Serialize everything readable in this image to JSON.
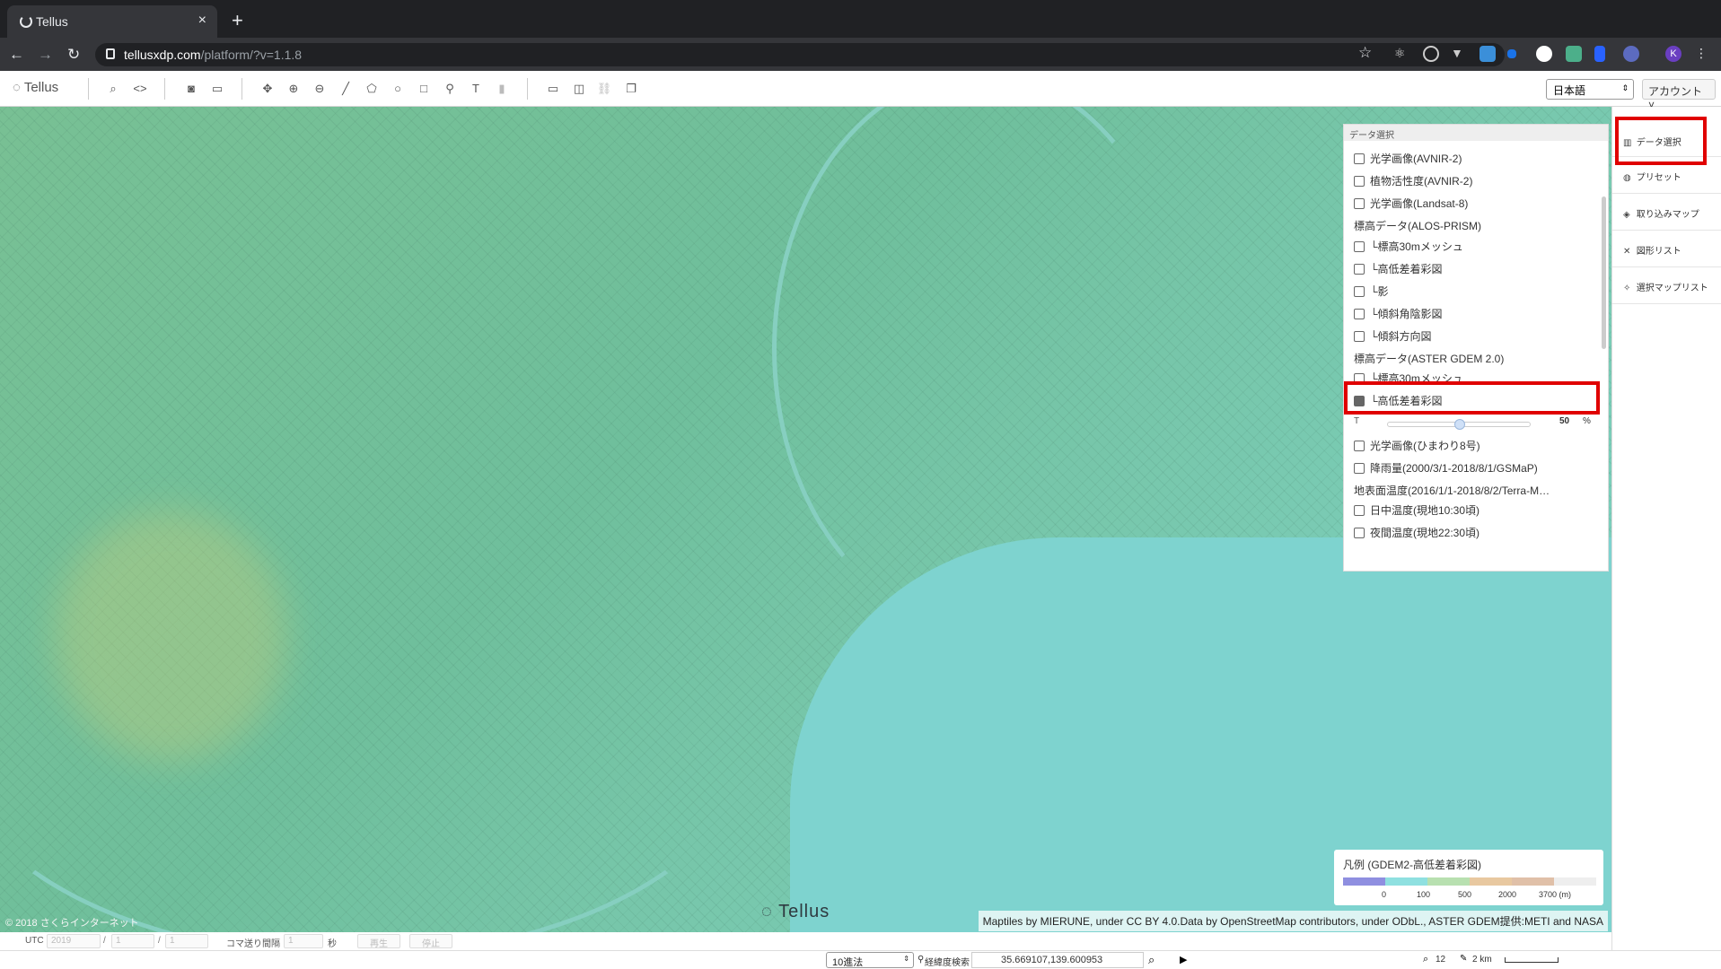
{
  "browser": {
    "tab_title": "Tellus",
    "url_host": "tellusxdp.com",
    "url_path": "/platform/?v=1.1.8",
    "profile_initial": "K"
  },
  "toolbar": {
    "logo": "Tellus",
    "language": "日本語",
    "account": "アカウント"
  },
  "data_panel": {
    "header": "データ選択",
    "items": [
      {
        "label": "光学画像(AVNIR-2)",
        "type": "check",
        "checked": false
      },
      {
        "label": "植物活性度(AVNIR-2)",
        "type": "check",
        "checked": false
      },
      {
        "label": "光学画像(Landsat-8)",
        "type": "check",
        "checked": false
      },
      {
        "label": "標高データ(ALOS-PRISM)",
        "type": "group"
      },
      {
        "label": "└標高30mメッシュ",
        "type": "check",
        "checked": false
      },
      {
        "label": "└高低差着彩図",
        "type": "check",
        "checked": false
      },
      {
        "label": "└影",
        "type": "check",
        "checked": false
      },
      {
        "label": "└傾斜角陰影図",
        "type": "check",
        "checked": false
      },
      {
        "label": "└傾斜方向図",
        "type": "check",
        "checked": false
      },
      {
        "label": "標高データ(ASTER GDEM 2.0)",
        "type": "group"
      },
      {
        "label": "└標高30mメッシュ",
        "type": "check",
        "checked": false
      },
      {
        "label": "└高低差着彩図",
        "type": "check",
        "checked": true
      },
      {
        "label": "光学画像(ひまわり8号)",
        "type": "check",
        "checked": false
      },
      {
        "label": "降雨量(2000/3/1-2018/8/1/GSMaP)",
        "type": "check",
        "checked": false
      },
      {
        "label": "地表面温度(2016/1/1-2018/8/2/Terra-M…",
        "type": "group"
      },
      {
        "label": "日中温度(現地10:30頃)",
        "type": "check",
        "checked": false
      },
      {
        "label": "夜間温度(現地22:30頃)",
        "type": "check",
        "checked": false
      }
    ],
    "opacity_label": "T",
    "opacity_value": "50",
    "opacity_unit": "%",
    "opacity_fraction": 0.5
  },
  "right_menu": {
    "items": [
      {
        "label": "データ選択",
        "icon": "map-icon"
      },
      {
        "label": "プリセット",
        "icon": "palette-icon"
      },
      {
        "label": "取り込みマップ",
        "icon": "layers-icon"
      },
      {
        "label": "図形リスト",
        "icon": "tools-icon"
      },
      {
        "label": "選択マップリスト",
        "icon": "pin-list-icon"
      }
    ]
  },
  "legend": {
    "title": "凡例 (GDEM2-高低差着彩図)",
    "ticks": [
      "0",
      "100",
      "500",
      "2000",
      "3700 (m)"
    ],
    "colors": [
      "#8f8fe0",
      "#8fe0e0",
      "#b8e0b0",
      "#e8c8a0",
      "#e0c0a8",
      "#eeeeee"
    ]
  },
  "map": {
    "copyright": "© 2018 さくらインターネット",
    "attribution": "Maptiles by MIERUNE, under CC BY 4.0.Data by OpenStreetMap contributors, under ODbL., ASTER GDEM提供:METI and NASA",
    "watermark": "Tellus"
  },
  "time_bar": {
    "utc": "UTC",
    "year": "2019",
    "month": "1",
    "day": "1",
    "slash": "/",
    "frame_label": "コマ送り間隔",
    "frame_value": "1",
    "sec": "秒",
    "play": "再生",
    "stop": "停止"
  },
  "status_bar": {
    "coord_format": "10進法",
    "coord_search_label": "経緯度検索",
    "coord_value": "35.669107,139.600953",
    "zoom": "12",
    "scale": "2 km"
  }
}
